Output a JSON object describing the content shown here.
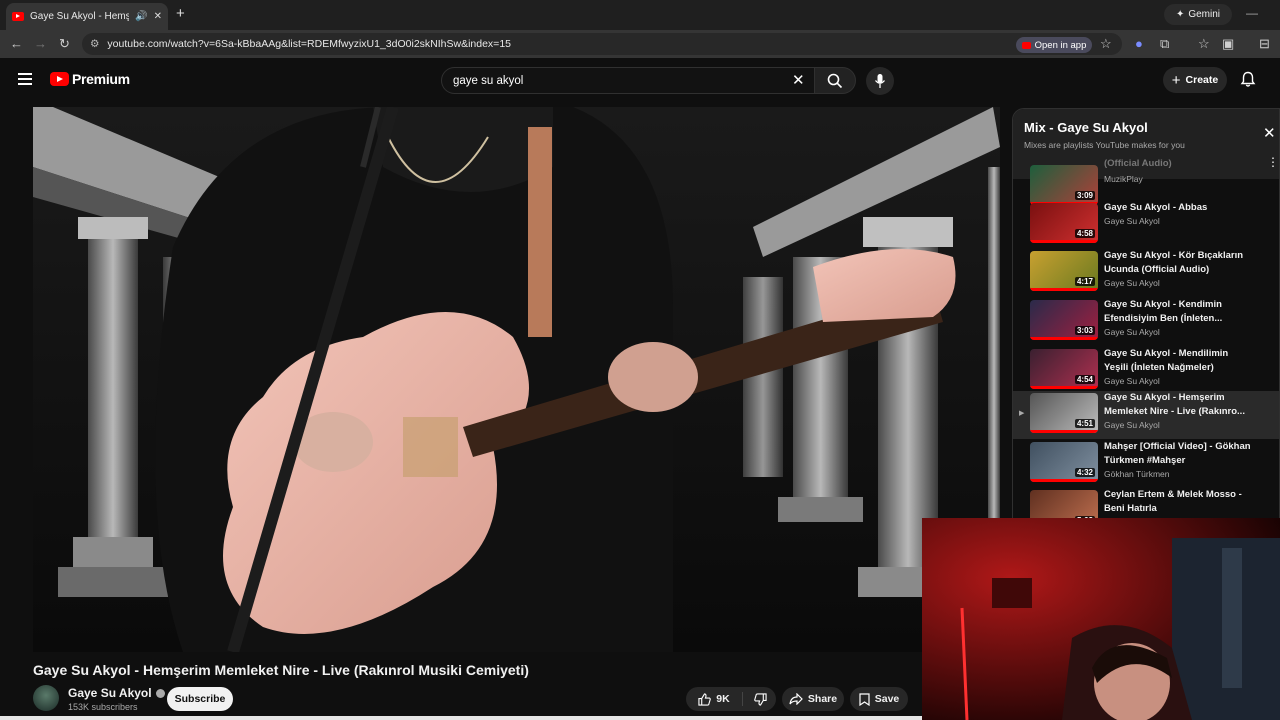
{
  "browser": {
    "tab_title": "Gaye Su Akyol - Hemşerim",
    "url": "youtube.com/watch?v=6Sa-kBbaAAg&list=RDEMfwyzixU1_3dO0i2skNIhSw&index=15",
    "open_in_app": "Open in app",
    "gemini": "Gemini"
  },
  "youtube": {
    "logo_label": "Premium",
    "search_value": "gaye su akyol",
    "create_label": "Create"
  },
  "video": {
    "title": "Gaye Su Akyol - Hemşerim Memleket Nire - Live (Rakınrol Musiki Cemiyeti)",
    "channel": "Gaye Su Akyol",
    "subscribers": "153K subscribers",
    "subscribe_label": "Subscribe",
    "likes": "9K",
    "share_label": "Share",
    "save_label": "Save"
  },
  "playlist": {
    "title": "Mix - Gaye Su Akyol",
    "subtitle": "Mixes are playlists YouTube makes for you",
    "items": [
      {
        "title": "(Official Audio)",
        "channel": "MuzikPlay",
        "duration": "3:09",
        "colors": [
          "#1d5f3c",
          "#b0403a"
        ]
      },
      {
        "title": "Gaye Su Akyol - Abbas",
        "channel": "Gaye Su Akyol",
        "duration": "4:58",
        "colors": [
          "#7a1010",
          "#d03030"
        ]
      },
      {
        "title": "Gaye Su Akyol - Kör Bıçakların Ucunda (Official Audio)",
        "channel": "Gaye Su Akyol",
        "duration": "4:17",
        "colors": [
          "#c8a030",
          "#6a7a20"
        ]
      },
      {
        "title": "Gaye Su Akyol - Kendimin Efendisiyim Ben (İnleten...",
        "channel": "Gaye Su Akyol",
        "duration": "3:03",
        "colors": [
          "#2a2a4a",
          "#a02040"
        ]
      },
      {
        "title": "Gaye Su Akyol - Mendilimin Yeşili (İnleten Nağmeler)",
        "channel": "Gaye Su Akyol",
        "duration": "4:54",
        "colors": [
          "#3a2030",
          "#b03050"
        ]
      },
      {
        "title": "Gaye Su Akyol - Hemşerim Memleket Nire - Live (Rakınro...",
        "channel": "Gaye Su Akyol",
        "duration": "4:51",
        "colors": [
          "#555555",
          "#bdbdbd"
        ]
      },
      {
        "title": "Mahşer [Official Video] - Gökhan Türkmen #Mahşer",
        "channel": "Gökhan Türkmen",
        "duration": "4:32",
        "colors": [
          "#405060",
          "#8090a0"
        ]
      },
      {
        "title": "Ceylan Ertem & Melek Mosso - Beni Hatırla",
        "channel": "",
        "duration": "5:03",
        "colors": [
          "#603020",
          "#c07050"
        ]
      }
    ]
  },
  "colors": {
    "accent": "#ff0000",
    "background": "#0f0f0f"
  }
}
